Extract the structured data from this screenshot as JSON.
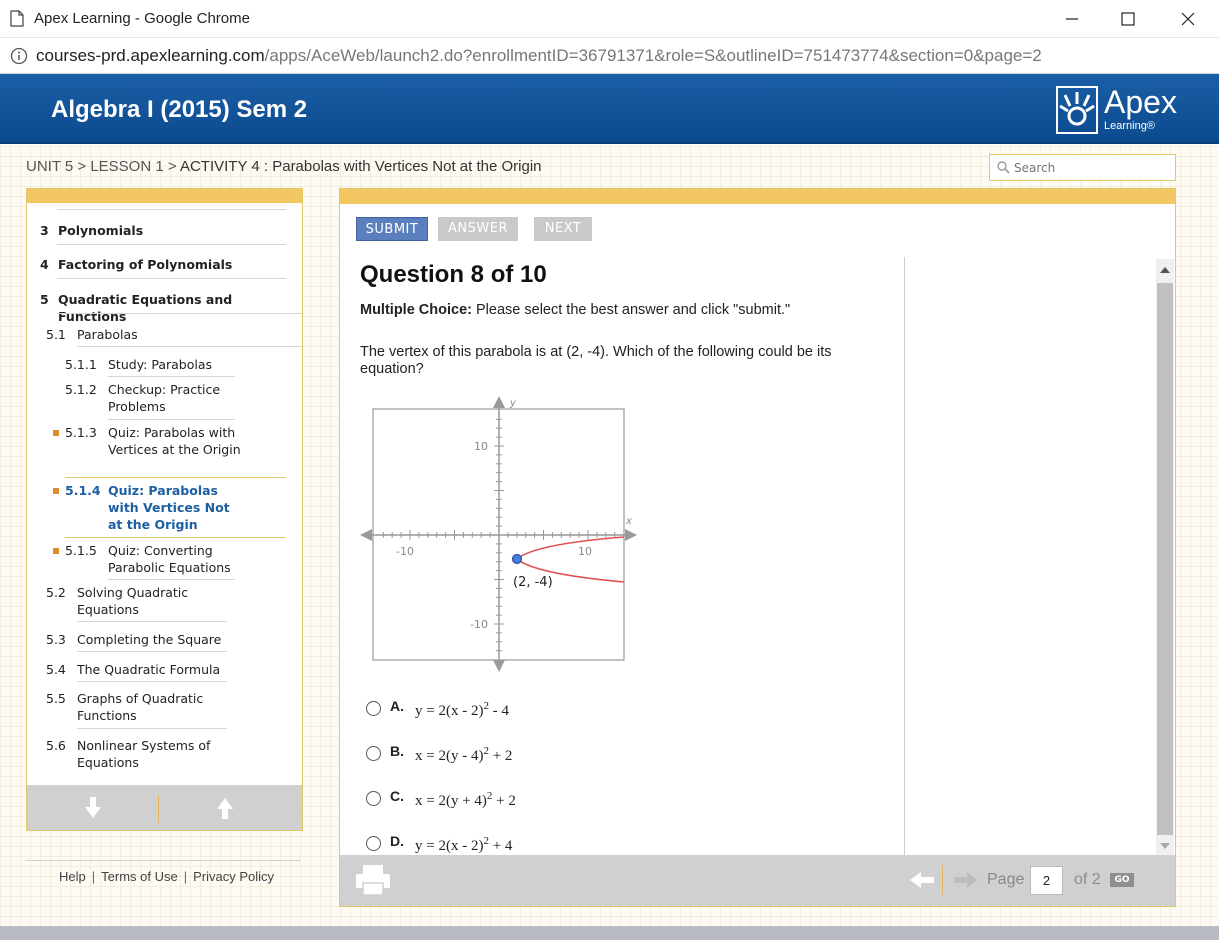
{
  "window": {
    "title": "Apex Learning - Google Chrome",
    "url_host": "courses-prd.apexlearning.com",
    "url_path": "/apps/AceWeb/launch2.do?enrollmentID=36791371&role=S&outlineID=751473774&section=0&page=2"
  },
  "header": {
    "course_title": "Algebra I (2015) Sem 2",
    "logo_word": "Apex",
    "logo_sub": "Learning®"
  },
  "breadcrumb": {
    "path": "UNIT 5 > LESSON 1 > ",
    "current": "ACTIVITY 4 : Parabolas with Vertices Not at the Origin"
  },
  "search": {
    "placeholder": "Search"
  },
  "outline": {
    "units": [
      {
        "num": "3",
        "label": "Polynomials"
      },
      {
        "num": "4",
        "label": "Factoring of Polynomials"
      },
      {
        "num": "5",
        "label": "Quadratic Equations and Functions"
      }
    ],
    "lesson": {
      "num": "5.1",
      "label": "Parabolas"
    },
    "activities": [
      {
        "num": "5.1.1",
        "label": "Study: Parabolas"
      },
      {
        "num": "5.1.2",
        "label": "Checkup: Practice Problems"
      },
      {
        "num": "5.1.3",
        "label": "Quiz: Parabolas with Vertices at the Origin"
      },
      {
        "num": "5.1.4",
        "label": "Quiz: Parabolas with Vertices Not at the Origin"
      },
      {
        "num": "5.1.5",
        "label": "Quiz: Converting Parabolic Equations"
      }
    ],
    "lessons": [
      {
        "num": "5.2",
        "label": "Solving Quadratic Equations"
      },
      {
        "num": "5.3",
        "label": "Completing the Square"
      },
      {
        "num": "5.4",
        "label": "The Quadratic Formula"
      },
      {
        "num": "5.5",
        "label": "Graphs of Quadratic Functions"
      },
      {
        "num": "5.6",
        "label": "Nonlinear Systems of Equations"
      }
    ]
  },
  "footer": {
    "help": "Help",
    "terms": "Terms of Use",
    "privacy": "Privacy Policy"
  },
  "toolbar": {
    "submit": "SUBMIT",
    "answer": "ANSWER",
    "next": "NEXT"
  },
  "question": {
    "heading": "Question 8 of 10",
    "instr_bold": "Multiple Choice:",
    "instr_rest": " Please select the best answer and click \"submit.\"",
    "text": "The vertex of this parabola is at (2, -4). Which of the following could be its equation?",
    "graph": {
      "x_label": "x",
      "y_label": "y",
      "tick_pos_x": "10",
      "tick_neg_x": "-10",
      "tick_pos_y": "10",
      "tick_neg_y": "-10",
      "vertex_label": "(2, -4)"
    },
    "choices": [
      {
        "letter": "A.",
        "lhs": "y = 2(x - 2)",
        "exp": "2",
        "rhs": " - 4"
      },
      {
        "letter": "B.",
        "lhs": "x = 2(y - 4)",
        "exp": "2",
        "rhs": " + 2"
      },
      {
        "letter": "C.",
        "lhs": "x = 2(y + 4)",
        "exp": "2",
        "rhs": " + 2"
      },
      {
        "letter": "D.",
        "lhs": "y = 2(x - 2)",
        "exp": "2",
        "rhs": " + 4"
      }
    ]
  },
  "pager": {
    "page_label": "Page",
    "page_value": "2",
    "of_label": "of 2",
    "go": "GO"
  }
}
